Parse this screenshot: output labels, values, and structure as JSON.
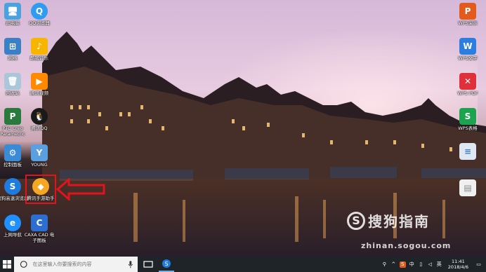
{
  "desktop": {
    "left_icons": [
      {
        "label": "此电脑",
        "icon": "computer-icon",
        "color": "#4aa3df"
      },
      {
        "label": "QQ浏览器",
        "icon": "qq-browser-icon",
        "color": "#2f9cf0"
      },
      {
        "label": "网络",
        "icon": "network-icon",
        "color": "#3b7fc4"
      },
      {
        "label": "酷我音乐",
        "icon": "kuwo-music-icon",
        "color": "#f7b500"
      },
      {
        "label": "回收站",
        "icon": "recycle-bin-icon",
        "color": "#a9c7d8"
      },
      {
        "label": "腾讯视频",
        "icon": "tencent-video-icon",
        "color": "#ff8a00"
      },
      {
        "label": "PTC Creo Parametric",
        "icon": "ptc-creo-icon",
        "color": "#2a7a3d"
      },
      {
        "label": "腾讯QQ",
        "icon": "qq-icon",
        "color": "#1a1a1a"
      },
      {
        "label": "控制面板",
        "icon": "control-panel-icon",
        "color": "#3b8ad6"
      },
      {
        "label": "YOUNG",
        "icon": "young-icon",
        "color": "#5aa0e0"
      },
      {
        "label": "搜狗高速浏览器",
        "icon": "sogou-browser-icon",
        "color": "#1e7be0"
      },
      {
        "label": "腾讯手游助手",
        "icon": "tencent-game-assistant-icon",
        "color": "#f5a623"
      },
      {
        "label": "上网导航",
        "icon": "ie-icon",
        "color": "#1e90ff"
      },
      {
        "label": "CAXA CAD 电子图板",
        "icon": "caxa-cad-icon",
        "color": "#2d6fd0"
      }
    ],
    "right_icons": [
      {
        "label": "WPS演示",
        "icon": "wps-presentation-icon",
        "color": "#e25b1c"
      },
      {
        "label": "WPS文字",
        "icon": "wps-writer-icon",
        "color": "#2b7de0"
      },
      {
        "label": "WPS PDF",
        "icon": "wps-pdf-icon",
        "color": "#e0303a"
      },
      {
        "label": "WPS表格",
        "icon": "wps-sheet-icon",
        "color": "#1da34f"
      },
      {
        "label": "",
        "icon": "document-icon",
        "color": "#dfe8f2"
      },
      {
        "label": "",
        "icon": "file-icon",
        "color": "#f0f0f0"
      }
    ],
    "watermark": {
      "text": "搜狗指南",
      "url": "zhinan.sogou.com"
    }
  },
  "taskbar": {
    "search_placeholder": "在这里输入你要搜索的内容",
    "tray_lang": "英",
    "tray_ime": "中",
    "time": "11:41",
    "date": "2018/4/6"
  }
}
